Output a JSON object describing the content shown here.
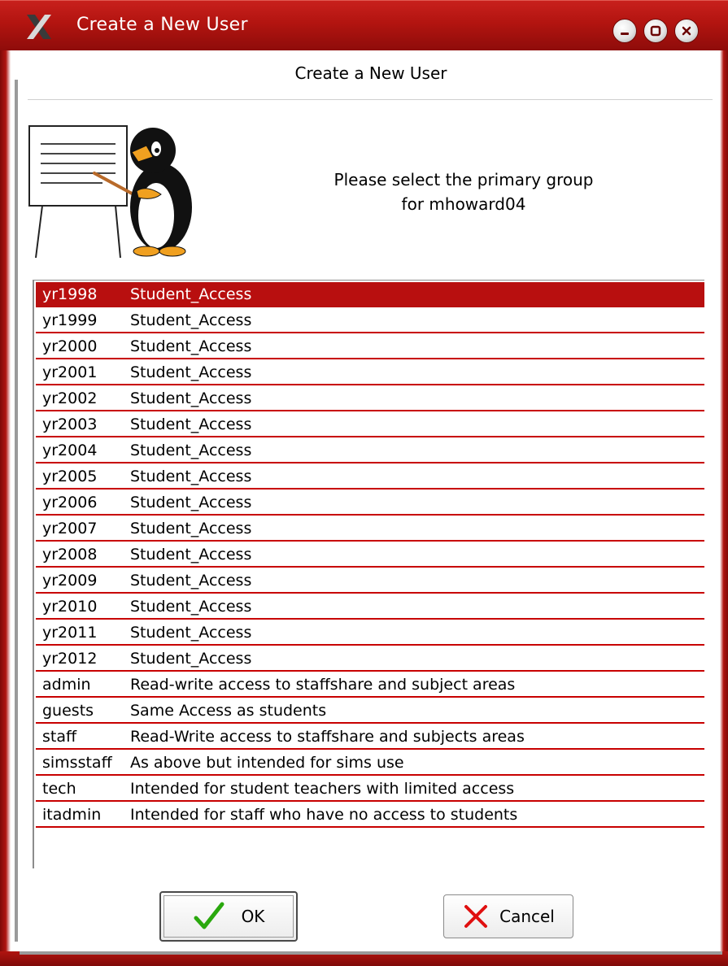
{
  "window": {
    "title": "Create a New User",
    "accent_color": "#b21410",
    "controls": [
      "minimize-icon",
      "maximize-icon",
      "close-icon"
    ]
  },
  "dialog": {
    "heading": "Create a New User",
    "prompt_line1": "Please select the primary group",
    "prompt_line2": "for mhoward04",
    "illustration": "penguin-teacher-icon"
  },
  "groups": [
    {
      "name": "yr1998",
      "description": "Student_Access",
      "selected": true
    },
    {
      "name": "yr1999",
      "description": "Student_Access"
    },
    {
      "name": "yr2000",
      "description": "Student_Access"
    },
    {
      "name": "yr2001",
      "description": "Student_Access"
    },
    {
      "name": "yr2002",
      "description": "Student_Access"
    },
    {
      "name": "yr2003",
      "description": "Student_Access"
    },
    {
      "name": "yr2004",
      "description": "Student_Access"
    },
    {
      "name": "yr2005",
      "description": "Student_Access"
    },
    {
      "name": "yr2006",
      "description": "Student_Access"
    },
    {
      "name": "yr2007",
      "description": "Student_Access"
    },
    {
      "name": "yr2008",
      "description": "Student_Access"
    },
    {
      "name": "yr2009",
      "description": "Student_Access"
    },
    {
      "name": "yr2010",
      "description": "Student_Access"
    },
    {
      "name": "yr2011",
      "description": "Student_Access"
    },
    {
      "name": "yr2012",
      "description": "Student_Access"
    },
    {
      "name": "admin",
      "description": "Read-write access to staffshare and subject areas"
    },
    {
      "name": "guests",
      "description": "Same Access as students"
    },
    {
      "name": "staff",
      "description": "Read-Write access to staffshare and subjects areas"
    },
    {
      "name": "simsstaff",
      "description": "As above but intended for sims use"
    },
    {
      "name": "tech",
      "description": "Intended for student teachers with limited access"
    },
    {
      "name": "itadmin",
      "description": "Intended for staff who have no access to students"
    }
  ],
  "buttons": {
    "ok_label": "OK",
    "ok_icon": "checkmark-icon",
    "cancel_label": "Cancel",
    "cancel_icon": "x-icon"
  },
  "colors": {
    "selection": "#b80f0f",
    "row_divider": "#c80000",
    "ok_check": "#2aa80e",
    "cancel_x": "#e01010"
  }
}
